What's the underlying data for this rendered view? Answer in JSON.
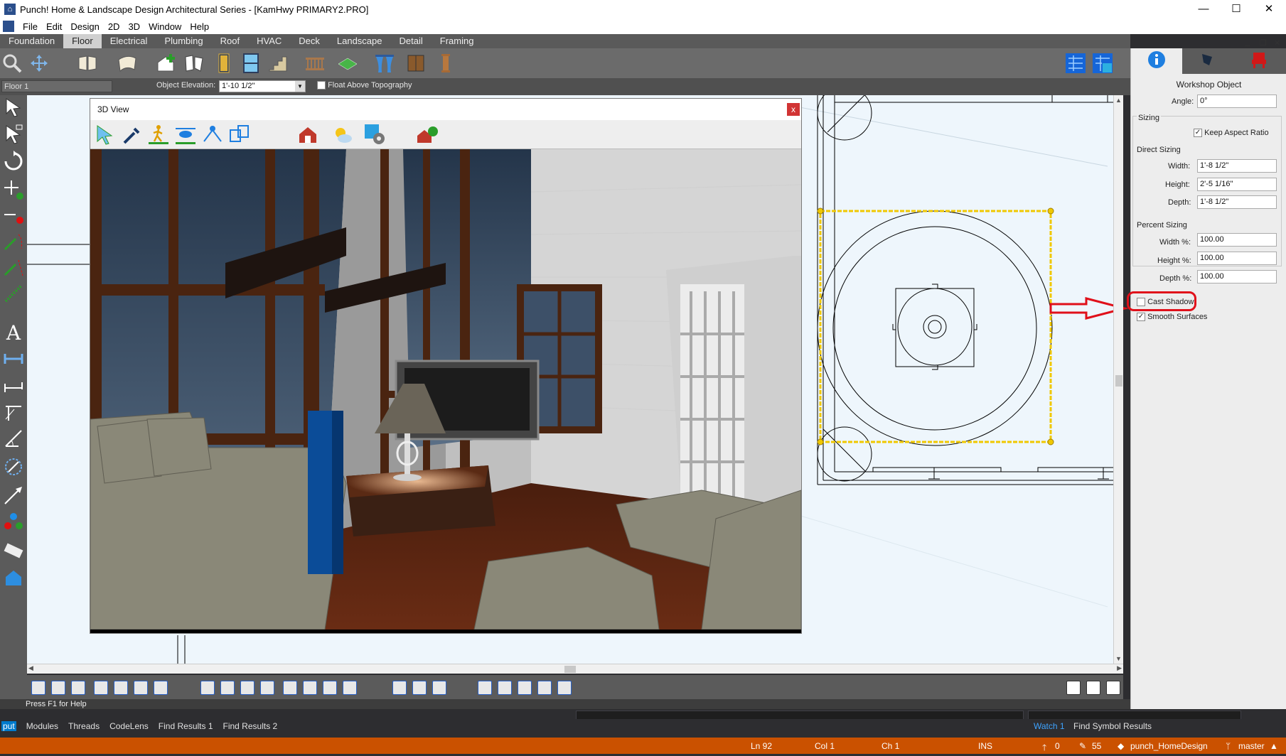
{
  "app": {
    "title": "Punch! Home & Landscape Design Architectural Series - [KamHwy PRIMARY2.PRO]",
    "controls": {
      "minimize": "—",
      "maximize": "☐",
      "close": "✕"
    }
  },
  "menu": [
    "File",
    "Edit",
    "Design",
    "2D",
    "3D",
    "Window",
    "Help"
  ],
  "mdi_controls": [
    "_",
    "❐",
    "✕"
  ],
  "tabs": [
    "Foundation",
    "Floor",
    "Electrical",
    "Plumbing",
    "Roof",
    "HVAC",
    "Deck",
    "Landscape",
    "Detail",
    "Framing"
  ],
  "active_tab": "Floor",
  "toolbar2": {
    "floor": "Floor 1",
    "elevation_label": "Object Elevation:",
    "elevation_value": "1'-10 1/2\"",
    "float_label": "Float Above Topography"
  },
  "view3d": {
    "title": "3D View",
    "close": "x"
  },
  "properties": {
    "header": "Workshop Object",
    "angle_label": "Angle:",
    "angle": "0°",
    "sizing": "Sizing",
    "keep_aspect": "Keep Aspect Ratio",
    "direct_sizing": "Direct Sizing",
    "width_label": "Width:",
    "width": "1'-8 1/2\"",
    "height_label": "Height:",
    "height": "2'-5 1/16\"",
    "depth_label": "Depth:",
    "depth": "1'-8 1/2\"",
    "percent_sizing": "Percent Sizing",
    "width_pct_label": "Width %:",
    "width_pct": "100.00",
    "height_pct_label": "Height %:",
    "height_pct": "100.00",
    "depth_pct_label": "Depth %:",
    "depth_pct": "100.00",
    "cast_shadow": "Cast Shadow",
    "smooth_surfaces": "Smooth Surfaces",
    "keep_aspect_checked": true,
    "cast_shadow_checked": false,
    "smooth_surfaces_checked": true
  },
  "status": "Press F1 for Help",
  "vs_tabs": [
    "put",
    "Modules",
    "Threads",
    "CodeLens",
    "Find Results 1",
    "Find Results 2"
  ],
  "vs_right_tabs": [
    "Watch 1",
    "Find Symbol Results"
  ],
  "vs_status": {
    "ln": "Ln 92",
    "col": "Col 1",
    "ch": "Ch 1",
    "ins": "INS",
    "up": "0",
    "edits": "55",
    "repo": "punch_HomeDesign",
    "branch": "master"
  },
  "colors": {
    "accent": "#ca5100",
    "selection": "#f0c800",
    "highlight": "#e0101a"
  }
}
